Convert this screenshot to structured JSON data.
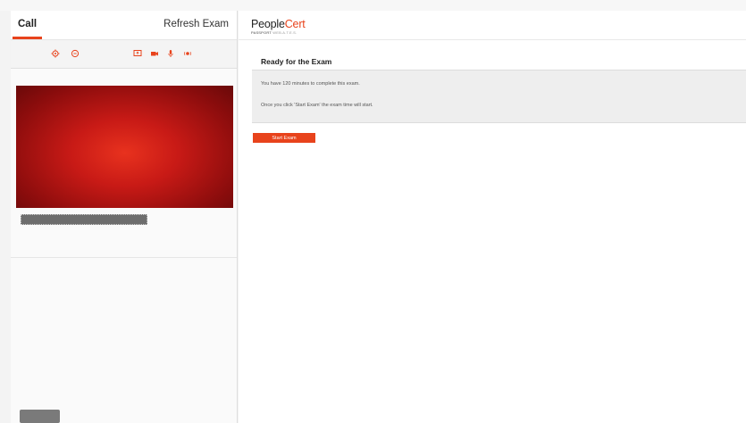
{
  "left": {
    "tabs": {
      "call": "Call",
      "refresh": "Refresh Exam"
    },
    "toolbar": {
      "icons": [
        "gear-icon",
        "chat-icon",
        "screen-share-icon",
        "video-camera-icon",
        "microphone-icon",
        "recording-indicator-icon"
      ],
      "accent_color": "#e8431c"
    }
  },
  "right": {
    "logo": {
      "people": "People",
      "cert": "Cert",
      "passport": "PASSPORT",
      "tagline": " WEB.A.T.E.S."
    },
    "title": "Ready for the Exam",
    "info": {
      "line1": "You have 120 minutes to complete this exam.",
      "line2": "Once you click 'Start Exam' the exam time will start."
    },
    "start_button": "Start Exam"
  }
}
